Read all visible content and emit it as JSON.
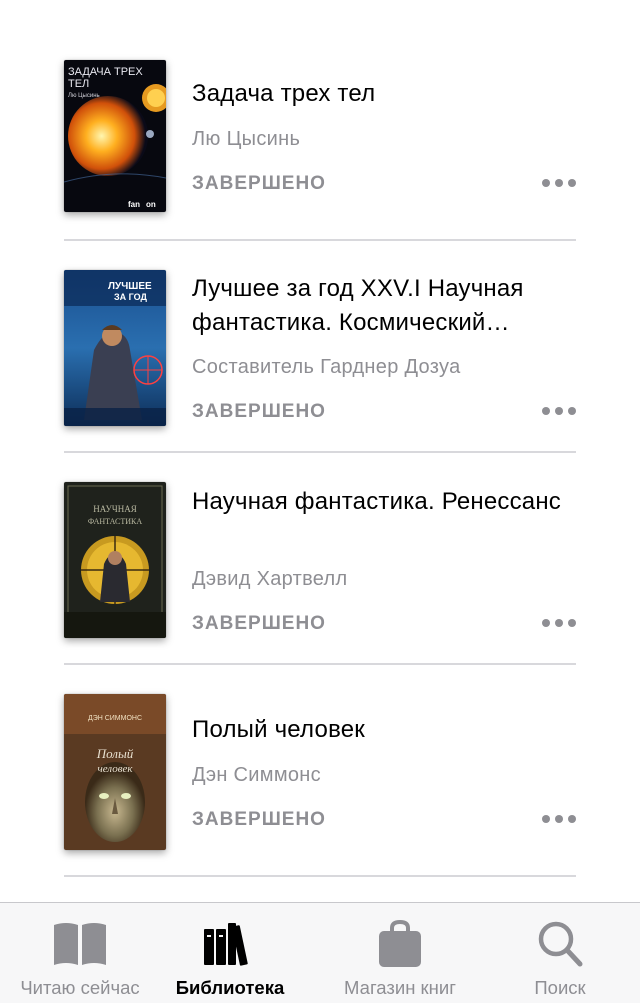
{
  "books": [
    {
      "title": "Задача трех тел",
      "author": "Лю Цысинь",
      "status": "ЗАВЕРШЕНО",
      "cover_text": [
        "ЗАДАЧА ТРЕХ",
        "ТЕЛ",
        "Лю Цысинь",
        "fan",
        "on"
      ]
    },
    {
      "title": "Лучшее за год XXV.I Научная фантастика. Космический…",
      "author": "Составитель Гарднер Дозуа",
      "status": "ЗАВЕРШЕНО",
      "cover_text": [
        "ЛУЧШЕЕ",
        "ЗА ГОД"
      ]
    },
    {
      "title": "Научная фантастика. Ренессанс",
      "author": "Дэвид Хартвелл",
      "status": "ЗАВЕРШЕНО",
      "cover_text": [
        "НАУЧНАЯ",
        "ФАНТАСТИКА"
      ]
    },
    {
      "title": "Полый человек",
      "author": "Дэн Симмонс",
      "status": "ЗАВЕРШЕНО",
      "cover_text": [
        "ДЭН СИММОНС",
        "Полый",
        "человек"
      ]
    }
  ],
  "tabbar": {
    "reading_now": "Читаю сейчас",
    "library": "Библиотека",
    "book_store": "Магазин книг",
    "search": "Поиск"
  },
  "icons": {
    "reading_now": "open-book-icon",
    "library": "books-icon",
    "book_store": "shopping-bag-icon",
    "search": "magnifier-icon",
    "more": "ellipsis-icon"
  },
  "colors": {
    "secondary_text": "#8e8e93",
    "active_tab": "#000000",
    "inactive_tab": "#8e8e93"
  }
}
